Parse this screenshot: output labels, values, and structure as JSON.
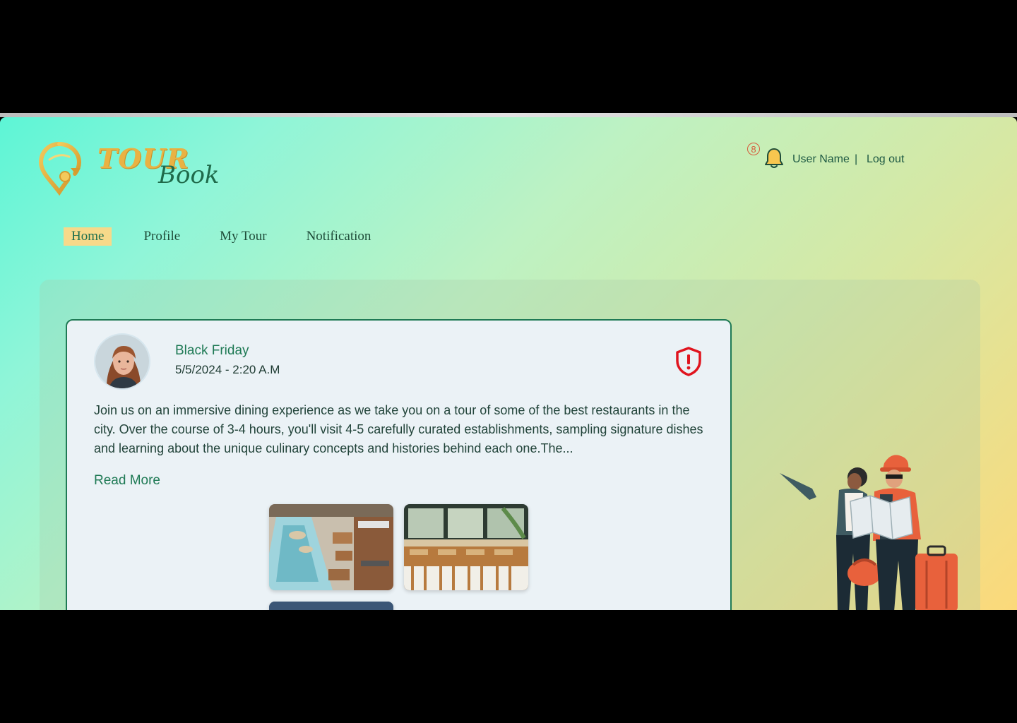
{
  "app": {
    "logo_primary": "TOUR",
    "logo_secondary": "Book"
  },
  "header": {
    "notification_count": "8",
    "user_name": "User Name",
    "separator": "|",
    "logout_label": "Log out"
  },
  "nav": {
    "items": [
      {
        "label": "Home",
        "active": true
      },
      {
        "label": "Profile",
        "active": false
      },
      {
        "label": "My Tour",
        "active": false
      },
      {
        "label": "Notification",
        "active": false
      }
    ]
  },
  "post": {
    "title": "Black Friday",
    "date": "5/5/2024 - 2:20 A.M",
    "body": "Join us on an immersive dining experience as we take you on a tour of some of the best restaurants in the city. Over the course of 3-4 hours, you'll visit 4-5 carefully curated establishments, sampling signature dishes and learning about the unique culinary concepts and histories behind each one.The...",
    "read_more_label": "Read More",
    "images": [
      "restaurant-pool-photo",
      "restaurant-bar-photo",
      "restaurant-interior-photo"
    ]
  },
  "colors": {
    "accent_green": "#1f7a55",
    "logo_gold": "#e9b243",
    "active_nav_bg": "#f7d98a",
    "report_red": "#e0141e"
  },
  "icons": {
    "notification": "bell-icon",
    "report": "shield-alert-icon",
    "logo": "location-pin-logo"
  }
}
